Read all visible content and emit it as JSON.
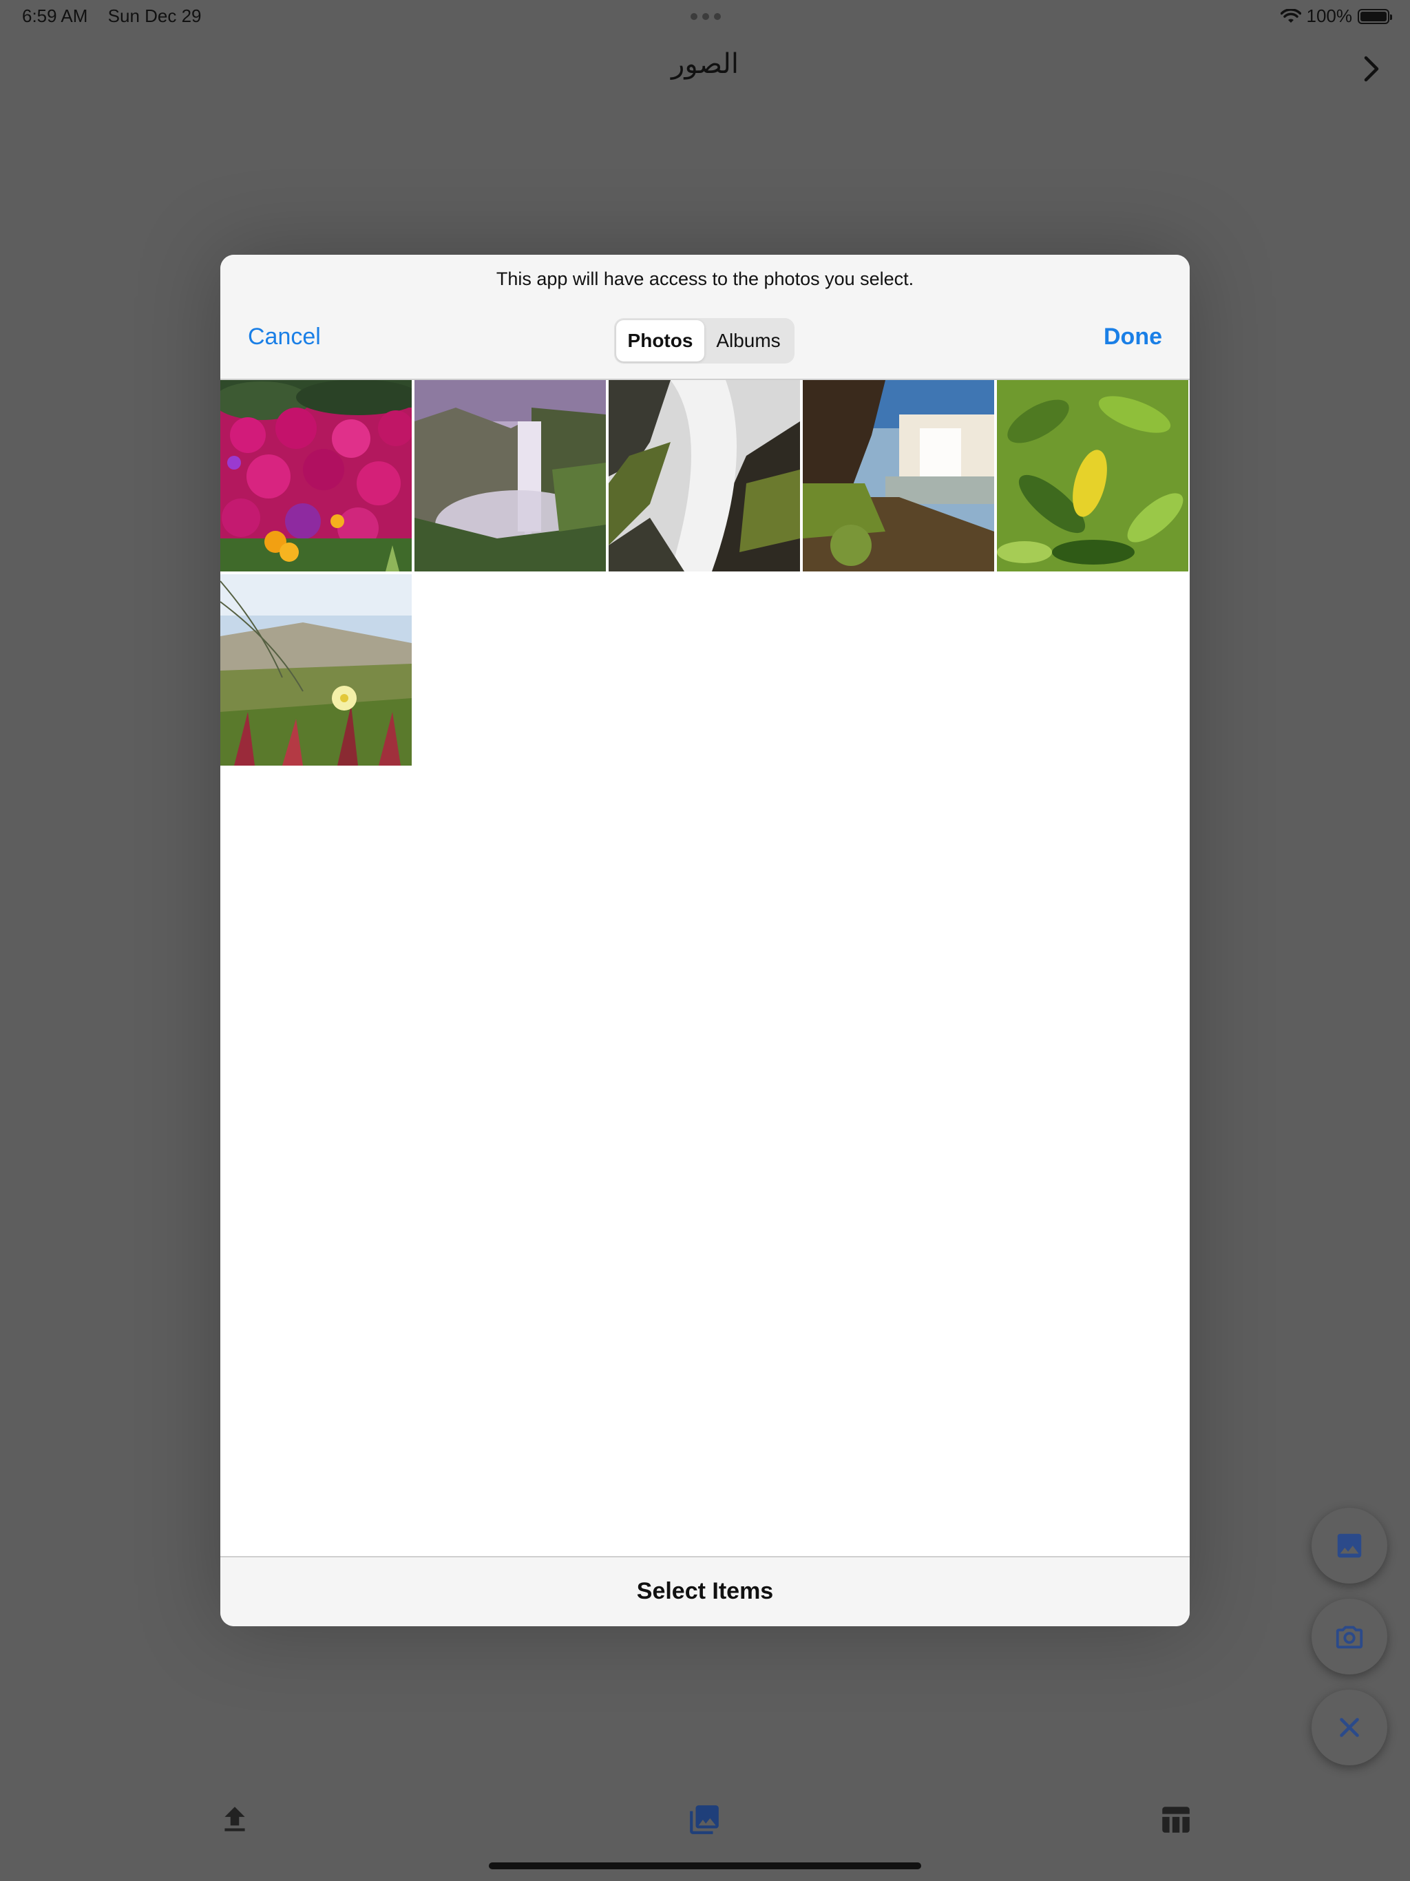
{
  "status_bar": {
    "time": "6:59 AM",
    "date": "Sun Dec 29",
    "battery_percent": "100%",
    "icons": [
      "wifi-icon",
      "battery-icon"
    ]
  },
  "nav": {
    "title": "الصور",
    "forward_icon": "chevron-right-icon"
  },
  "picker": {
    "access_note": "This app will have access to the photos you select.",
    "cancel_label": "Cancel",
    "done_label": "Done",
    "tabs": [
      {
        "label": "Photos",
        "selected": true
      },
      {
        "label": "Albums",
        "selected": false
      }
    ],
    "photos": [
      {
        "subject": "pink-flowers"
      },
      {
        "subject": "waterfall-mist"
      },
      {
        "subject": "waterfall-rocks"
      },
      {
        "subject": "waterfall-cliff"
      },
      {
        "subject": "green-leaves"
      },
      {
        "subject": "dune-flower"
      }
    ],
    "footer_label": "Select Items"
  },
  "fabs": [
    "image-icon",
    "camera-icon",
    "close-icon"
  ],
  "toolbar": [
    "upload-icon",
    "gallery-icon",
    "table-icon"
  ],
  "colors": {
    "accent": "#1a7fe6",
    "dim_background": "#5e5e5e",
    "fab_icon": "#2b4a8a"
  }
}
